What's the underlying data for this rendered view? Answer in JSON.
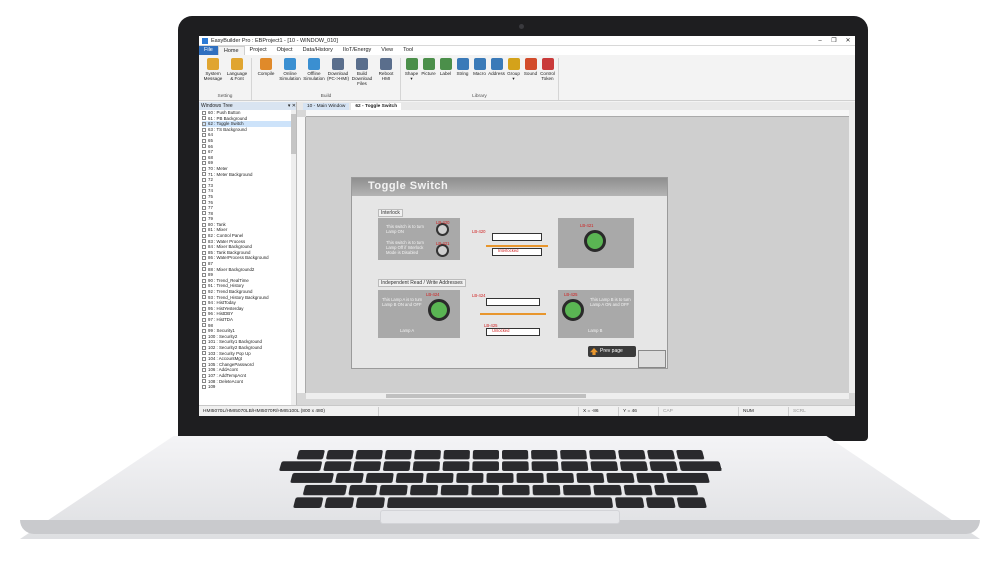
{
  "app": {
    "title": "EasyBuilder Pro : EBProject1 - [10 - WINDOW_010]",
    "window_controls": [
      "–",
      "❐",
      "✕"
    ]
  },
  "ribbon_tabs": [
    "File",
    "Home",
    "Project",
    "Object",
    "Data/History",
    "IIoT/Energy",
    "View",
    "Tool"
  ],
  "ribbon_groups": [
    {
      "label": "Setting",
      "buttons": [
        {
          "label": "System\nMessage",
          "icon": "system-message-icon",
          "color": "#e0a530"
        },
        {
          "label": "Language\n& Font",
          "icon": "language-font-icon",
          "color": "#e0a530"
        }
      ]
    },
    {
      "label": "Build",
      "buttons": [
        {
          "label": "Compile",
          "icon": "compile-icon",
          "color": "#e08a2a"
        },
        {
          "label": "Online\nSimulation",
          "icon": "online-simulation-icon",
          "color": "#3a8fd1"
        },
        {
          "label": "Offline\nSimulation",
          "icon": "offline-simulation-icon",
          "color": "#3a8fd1"
        },
        {
          "label": "Download\n(PC->HMI)",
          "icon": "download-icon",
          "color": "#5a6e8c"
        },
        {
          "label": "Build Download\nFiles",
          "icon": "build-download-icon",
          "color": "#5a6e8c"
        },
        {
          "label": "Reboot\nHMI",
          "icon": "reboot-icon",
          "color": "#5a6e8c"
        }
      ]
    },
    {
      "label": "Library",
      "buttons": [
        {
          "label": "Shape\n▾",
          "icon": "shape-icon",
          "color": "#4b8f4a"
        },
        {
          "label": "Picture",
          "icon": "picture-icon",
          "color": "#4b8f4a"
        },
        {
          "label": "Label",
          "icon": "label-icon",
          "color": "#4b8f4a"
        },
        {
          "label": "String",
          "icon": "string-icon",
          "color": "#3a7ab8"
        },
        {
          "label": "Macro",
          "icon": "macro-icon",
          "color": "#3a7ab8"
        },
        {
          "label": "Address",
          "icon": "address-icon",
          "color": "#3a7ab8"
        },
        {
          "label": "Group\n▾",
          "icon": "group-icon",
          "color": "#d4a21a"
        },
        {
          "label": "Sound",
          "icon": "sound-icon",
          "color": "#d24b2a"
        },
        {
          "label": "Control\nToken",
          "icon": "control-token-icon",
          "color": "#c93a3a"
        }
      ]
    }
  ],
  "windows_tree": {
    "title": "Windows Tree",
    "controls": "▾ ✕",
    "selected": "62 : Toggle Switch",
    "items": [
      "60 : Push Button",
      "61 : PB Background",
      "62 : Toggle Switch",
      "63 : TS Background",
      "64",
      "65",
      "66",
      "67",
      "68",
      "69",
      "70 : Meter",
      "71 : Meter Background",
      "72",
      "73",
      "74",
      "75",
      "76",
      "77",
      "78",
      "79",
      "80 : Tank",
      "81 : Mixer",
      "82 : Control Panel",
      "83 : Water Process",
      "84 : Mixer Background",
      "85 : Tank Background",
      "86 : WaterProcess Background",
      "87",
      "88 : Mixer Background2",
      "89",
      "90 : Trend_RealTime",
      "91 : Trend_History",
      "92 : Trend Background",
      "93 : Trend_History Background",
      "94 : HistToday",
      "95 : HistYesterday",
      "96 : HistDBY",
      "97 : HistTDA",
      "98",
      "99 : Security1",
      "100 : Security2",
      "101 : Security1 Background",
      "102 : Security2 Background",
      "103 : Security Pop Up",
      "104 : AccountMgt",
      "105 : ChangePassword",
      "106 : AddAcont",
      "107 : AddTempAcnt",
      "108 : DeleteAcont",
      "109"
    ]
  },
  "editor_tabs": [
    "10 - Main Window",
    "62 - Toggle Switch"
  ],
  "page": {
    "title": "Toggle Switch",
    "interlock_label": "Interlock",
    "independent_label": "Independent Read / Write Addresses",
    "switch1_text": "This switch is to turn Lamp ON",
    "switch2_text": "This switch is to turn Lamp Off if Interlock Mode is Disabled",
    "lamp_a_text": "This Lamp A is to turn Lamp B ON and OFF",
    "lamp_b_text": "This Lamp B is to turn Lamp A ON and OFF",
    "lamp_a_label": "Lamp A",
    "lamp_b_label": "Lamp B",
    "interlocked_label": "Interlocked",
    "unlocked_label": "Unlocked",
    "addr1": "LB-420",
    "addr2": "LB-421",
    "addr3": "LB-424",
    "addr4": "LB-425",
    "prev_page": "Prev page"
  },
  "status": {
    "model": "HMI5070L/HMI5070LB/HMI5070R/HMI5100L (800 x 480)",
    "x": "X = -86",
    "y": "Y = 46",
    "cap": "CAP",
    "num": "NUM",
    "scrl": "SCRL"
  }
}
